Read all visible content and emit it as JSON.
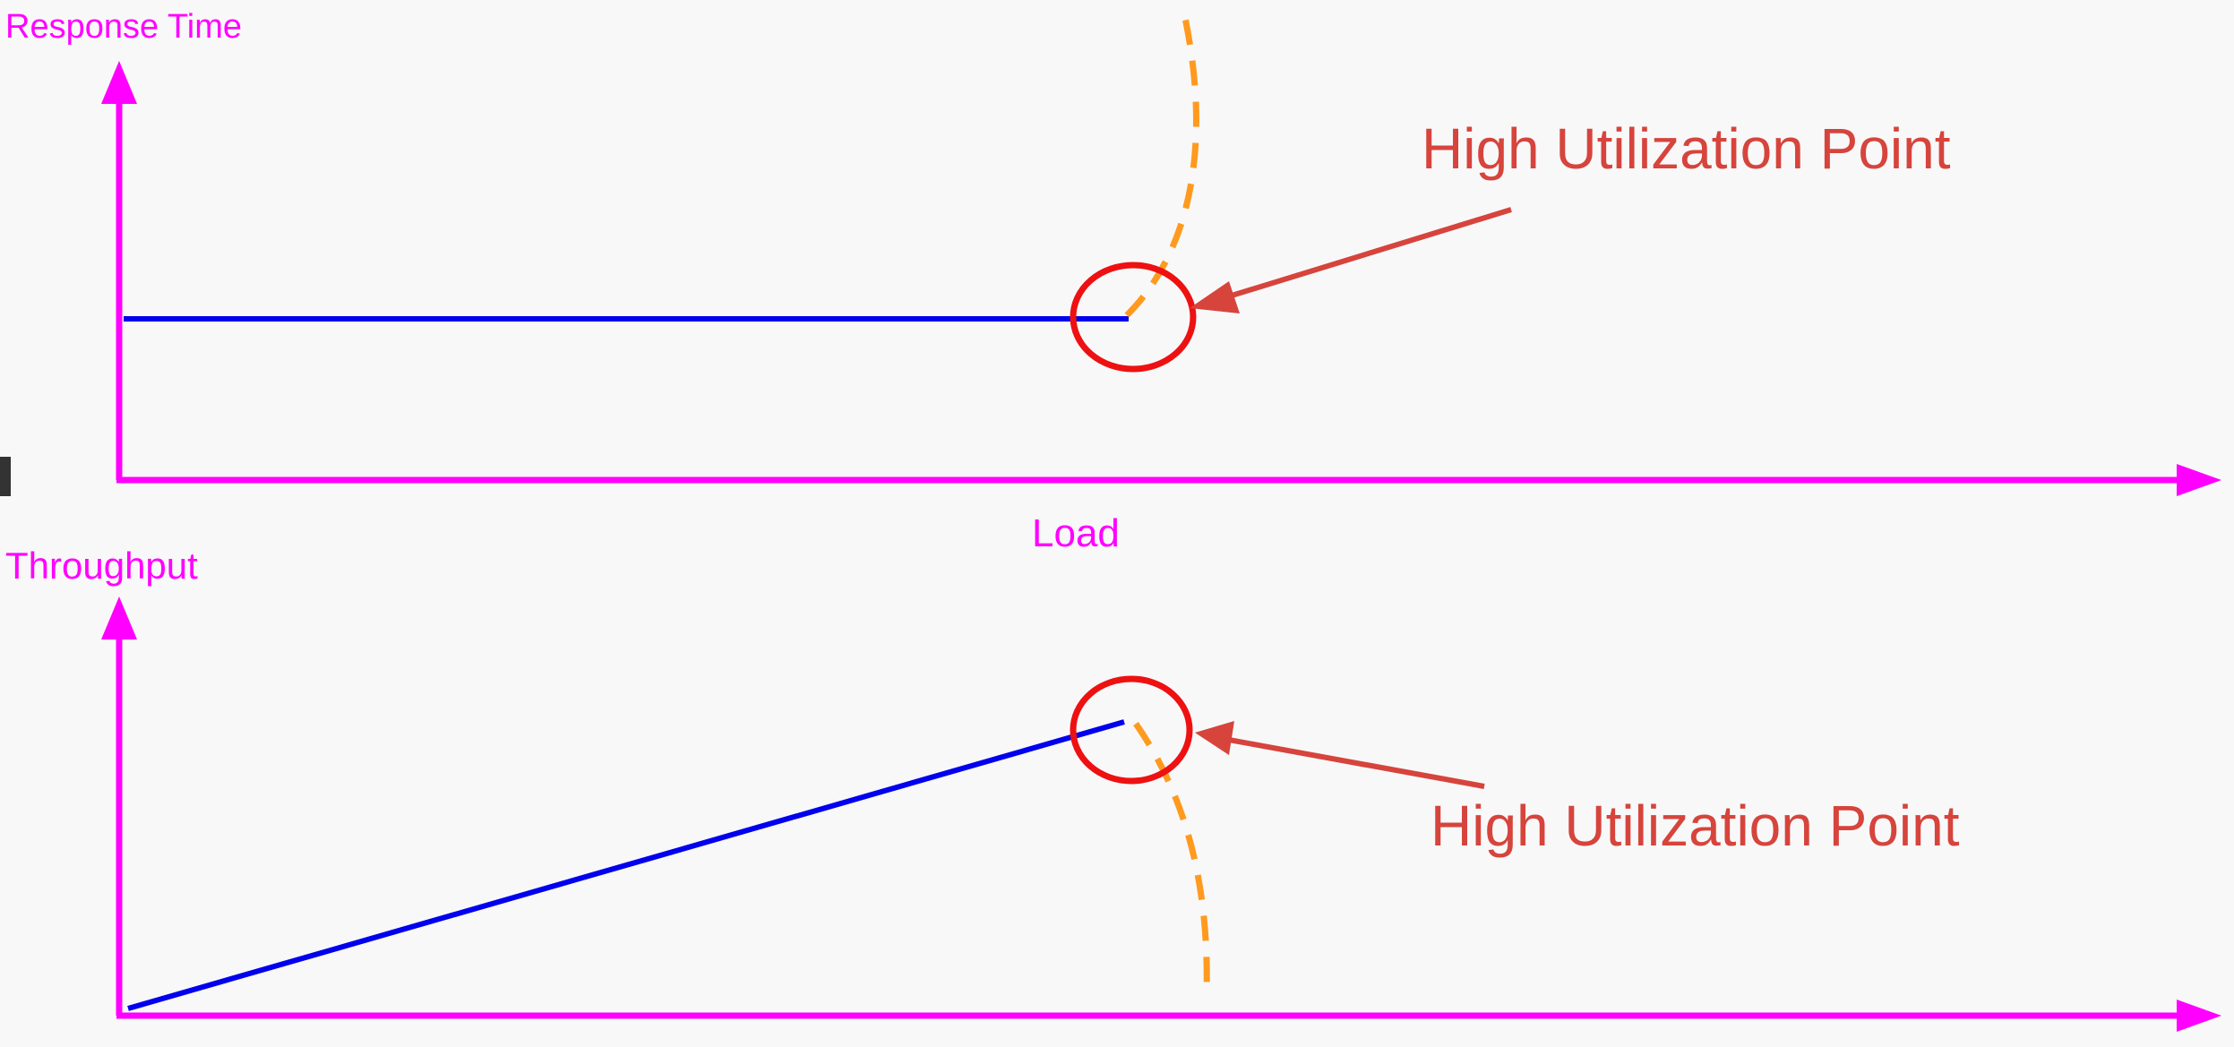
{
  "colors": {
    "axis": "#ff00ff",
    "normal_line": "#0000ee",
    "degraded_line": "#ff9a1f",
    "circle": "#ee1111",
    "callout": "#d6443c",
    "background": "#f8f8f9"
  },
  "top_chart": {
    "y_axis_label": "Response Time",
    "callout_label": "High Utilization Point"
  },
  "bottom_chart": {
    "y_axis_label": "Throughput",
    "callout_label": "High Utilization Point"
  },
  "shared": {
    "x_axis_label": "Load"
  }
}
